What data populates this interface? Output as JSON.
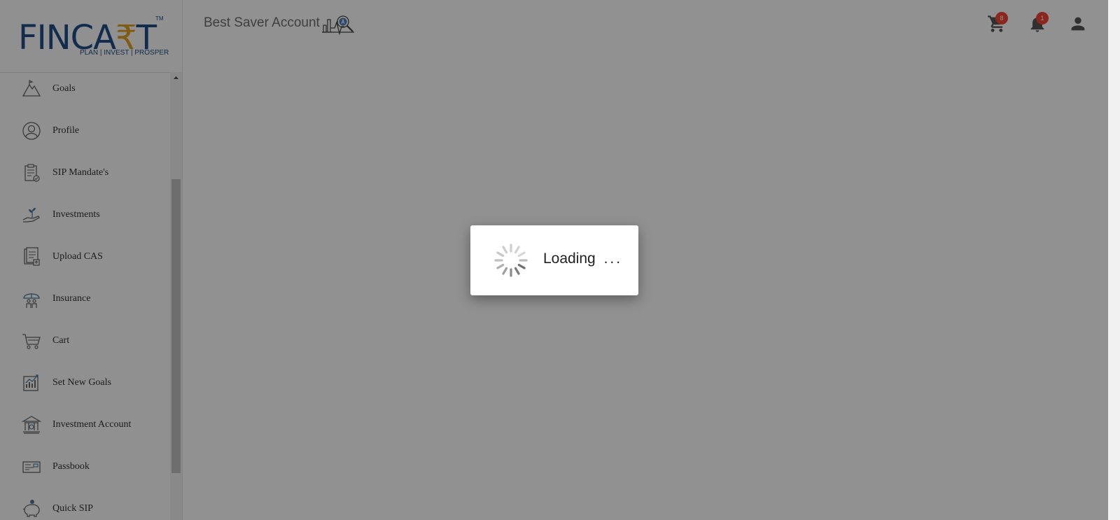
{
  "brand": {
    "logo_text_a": "FINCA",
    "logo_text_r": "₹",
    "logo_text_b": "T",
    "trademark": "TM",
    "tagline": "PLAN | INVEST | PROSPER"
  },
  "header": {
    "title": "Best Saver Account",
    "cart_badge": "8",
    "notification_badge": "1"
  },
  "sidebar": {
    "items": [
      {
        "label": "Goals",
        "icon": "mountain-icon"
      },
      {
        "label": "Profile",
        "icon": "profile-icon"
      },
      {
        "label": "SIP Mandate's",
        "icon": "clipboard-icon"
      },
      {
        "label": "Investments",
        "icon": "plant-hand-icon"
      },
      {
        "label": "Upload CAS",
        "icon": "document-upload-icon"
      },
      {
        "label": "Insurance",
        "icon": "umbrella-family-icon"
      },
      {
        "label": "Cart",
        "icon": "cart-icon"
      },
      {
        "label": "Set New Goals",
        "icon": "goal-chart-icon"
      },
      {
        "label": "Investment Account",
        "icon": "bank-icon"
      },
      {
        "label": "Passbook",
        "icon": "passbook-icon"
      },
      {
        "label": "Quick SIP",
        "icon": "piggy-bank-icon"
      }
    ]
  },
  "loading": {
    "text": "Loading",
    "ellipsis": "..."
  },
  "colors": {
    "brand_blue": "#1f4e86",
    "brand_gold": "#e0a022",
    "badge_red": "#f44336",
    "overlay": "rgba(0,0,0,0.43)"
  }
}
